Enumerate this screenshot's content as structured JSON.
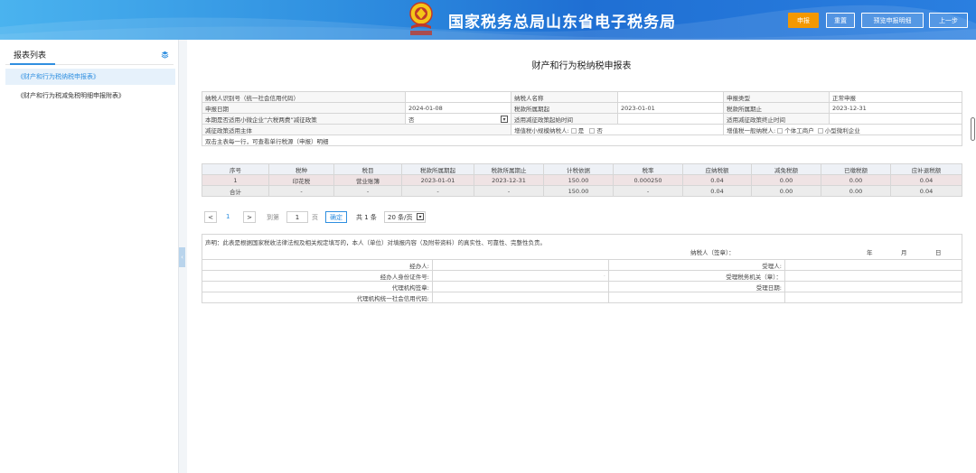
{
  "header": {
    "title": "国家税务总局山东省电子税务局",
    "buttons": [
      {
        "label": "申报",
        "primary": true
      },
      {
        "label": "重置",
        "primary": false
      },
      {
        "label": "预览申报明细",
        "primary": false
      },
      {
        "label": "上一步",
        "primary": false
      }
    ]
  },
  "sidebar": {
    "title": "报表列表",
    "items": [
      {
        "label": "《财产和行为税纳税申报表》",
        "active": true
      },
      {
        "label": "《财产和行为税减免税明细申报附表》",
        "active": false
      }
    ]
  },
  "report": {
    "title": "财产和行为税纳税申报表",
    "info": {
      "taxpayer_id_label": "纳税人识别号（统一社会信用代码）",
      "taxpayer_id_value": "",
      "taxpayer_name_label": "纳税人名称",
      "taxpayer_name_value": "",
      "decl_type_label": "申报类型",
      "decl_type_value": "正常申报",
      "decl_date_label": "申报日期",
      "decl_date_value": "2024-01-08",
      "period_start_label": "税款所属期起",
      "period_start_value": "2023-01-01",
      "period_end_label": "税款所属期止",
      "period_end_value": "2023-12-31",
      "six_tax_label": "本期是否适用小微企业“六税两费”减征政策",
      "six_tax_value": "否",
      "reduce_start_label": "适用减征政策起始时间",
      "reduce_start_value": "",
      "reduce_end_label": "适用减征政策终止时间",
      "reduce_end_value": "",
      "reduce_subject_label": "减征政策适用主体",
      "small_vat_label": "增值税小规模纳税人:",
      "yes_label": "是",
      "no_label": "否",
      "general_vat_label": "增值税一般纳税人:",
      "indiv_label": "个体工商户",
      "micro_label": "小型微利企业",
      "hint": "双击主表每一行，可查看单行税源（申报）明细"
    },
    "columns": [
      "序号",
      "税种",
      "税目",
      "税款所属期起",
      "税款所属期止",
      "计税依据",
      "税率",
      "应纳税额",
      "减免税额",
      "已缴税额",
      "应补退税额"
    ],
    "rows": [
      [
        "1",
        "印花税",
        "营业账簿",
        "2023-01-01",
        "2023-12-31",
        "150.00",
        "0.000250",
        "0.04",
        "0.00",
        "0.00",
        "0.04"
      ]
    ],
    "total_row": [
      "合计",
      "-",
      "-",
      "-",
      "-",
      "150.00",
      "-",
      "0.04",
      "0.00",
      "0.00",
      "0.04"
    ]
  },
  "pager": {
    "prev": "<",
    "page": "1",
    "next": ">",
    "goto_label": "到第",
    "goto_value": "1",
    "page_unit": "页",
    "confirm": "确定",
    "total": "共 1 条",
    "page_size": "20 条/页"
  },
  "declaration": {
    "statement": "声明：此表是根据国家税收法律法规及相关规定填写的，本人（单位）对填报内容（及附带资料）的真实性、可靠性、完整性负责。",
    "signer_label": "纳税人（签章）：",
    "year": "年",
    "month": "月",
    "day": "日",
    "agent_label": "经办人:",
    "agent_id_label": "经办人身份证件号:",
    "agency_seal_label": "代理机构签章:",
    "agency_code_label": "代理机构统一社会信用代码:",
    "receiver_label": "受理人:",
    "tax_office_label": "受理税务机关（章）：",
    "receive_date_label": "受理日期:",
    "dot": "·"
  }
}
